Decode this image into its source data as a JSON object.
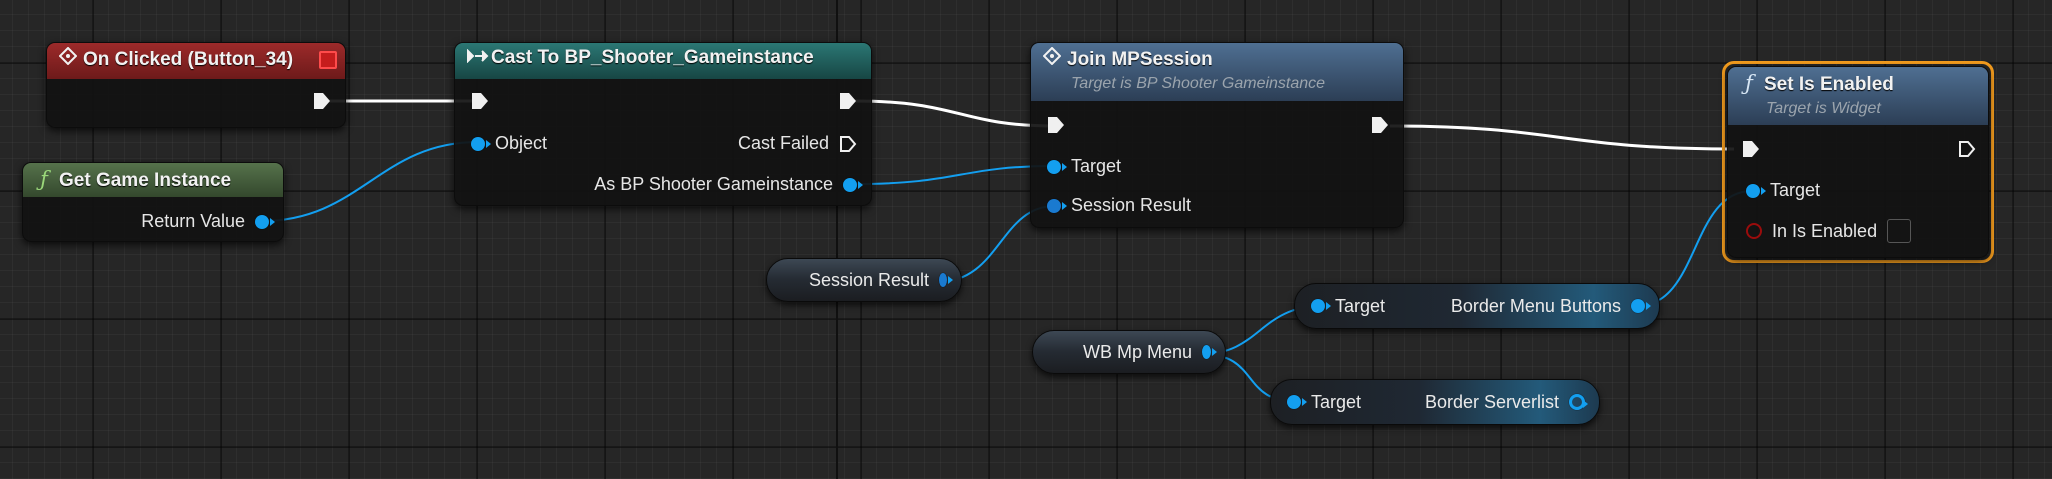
{
  "graph": {
    "nodes": {
      "on_clicked": {
        "title": "On Clicked (Button_34)",
        "header_color": "#7a1d1d"
      },
      "get_game_instance": {
        "title": "Get Game Instance",
        "pins": {
          "return_value": "Return Value"
        },
        "header_color": "#3f5a35"
      },
      "cast": {
        "title": "Cast To BP_Shooter_Gameinstance",
        "pins": {
          "object": "Object",
          "cast_failed": "Cast Failed",
          "as_result": "As BP Shooter Gameinstance"
        },
        "header_color": "#1e5c5a"
      },
      "join": {
        "title": "Join MPSession",
        "subtitle": "Target is BP Shooter Gameinstance",
        "pins": {
          "target": "Target",
          "session_result": "Session Result"
        },
        "header_color": "#3f5a78"
      },
      "session_var": {
        "label": "Session Result"
      },
      "set_enabled": {
        "title": "Set Is Enabled",
        "subtitle": "Target is Widget",
        "pins": {
          "target": "Target",
          "in_is_enabled": "In Is Enabled"
        },
        "header_color": "#3f5a78"
      },
      "wb_menu": {
        "label": "WB Mp Menu"
      },
      "get_border_menu": {
        "target": "Target",
        "member": "Border Menu Buttons"
      },
      "get_border_server": {
        "target": "Target",
        "member": "Border Serverlist"
      }
    },
    "colors": {
      "exec_wire": "#ffffff",
      "object_wire": "#139ff0",
      "bool_pin": "#9a0c0c",
      "selection": "#f39c1e"
    },
    "icons": {
      "event": "event-diamond-icon",
      "cast": "cast-arrow-icon",
      "function": "function-f-icon",
      "stop": "stop-square-icon"
    }
  }
}
